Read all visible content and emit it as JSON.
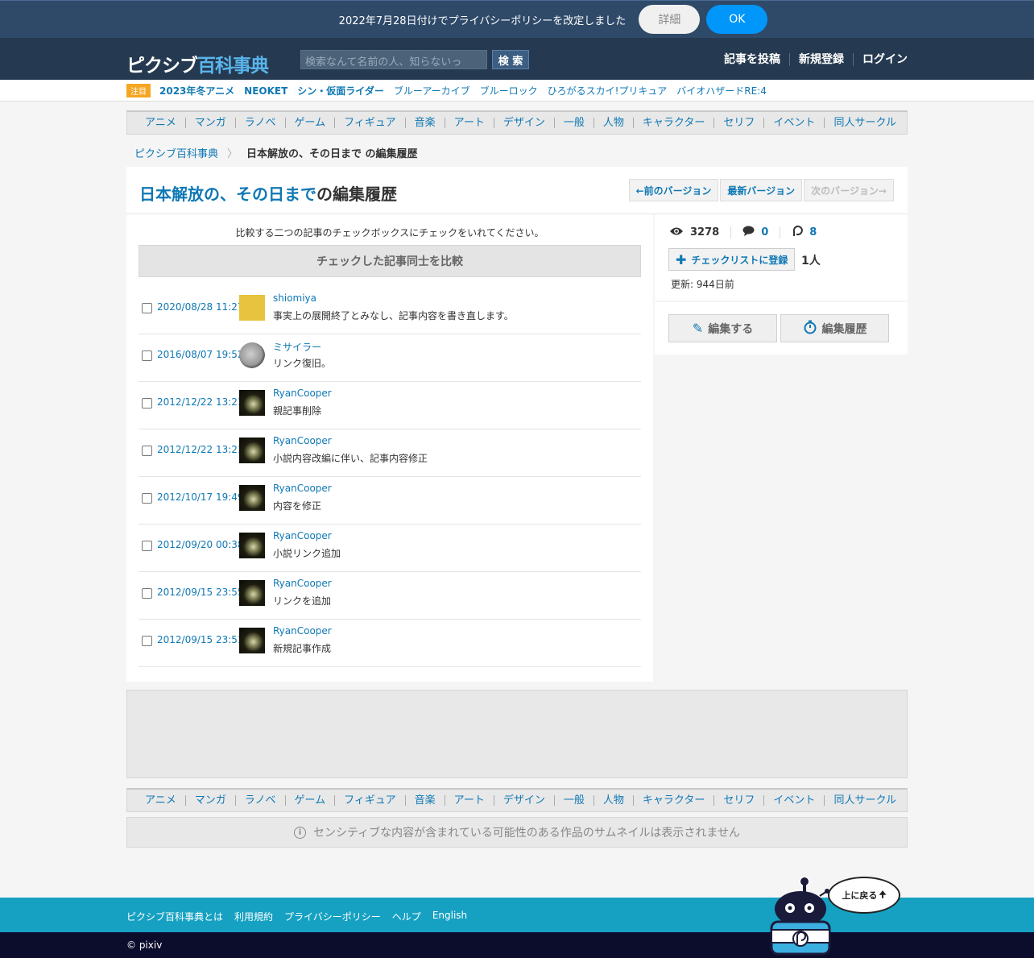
{
  "privacy_banner": {
    "message": "2022年7月28日付けでプライバシーポリシーを改定しました",
    "detail_label": "詳細",
    "ok_label": "OK"
  },
  "header": {
    "logo_part1": "ピクシブ",
    "logo_part2": "百科事典",
    "search_placeholder": "検索なんて名前の人、知らないっ",
    "search_label": "検 索",
    "links": [
      "記事を投稿",
      "新規登録",
      "ログイン"
    ]
  },
  "trending": {
    "badge": "注目",
    "items": [
      {
        "label": "2023年冬アニメ",
        "bold": true
      },
      {
        "label": "NEOKET",
        "bold": true
      },
      {
        "label": "シン・仮面ライダー",
        "bold": true
      },
      {
        "label": "ブルーアーカイブ",
        "bold": false
      },
      {
        "label": "ブルーロック",
        "bold": false
      },
      {
        "label": "ひろがるスカイ!プリキュア",
        "bold": false
      },
      {
        "label": "バイオハザードRE:4",
        "bold": false
      }
    ]
  },
  "categories": [
    "アニメ",
    "マンガ",
    "ラノベ",
    "ゲーム",
    "フィギュア",
    "音楽",
    "アート",
    "デザイン",
    "一般",
    "人物",
    "キャラクター",
    "セリフ",
    "イベント",
    "同人サークル"
  ],
  "breadcrumb": {
    "home": "ピクシブ百科事典",
    "separator": "〉",
    "current": "日本解放の、その日まで の編集履歴"
  },
  "title": {
    "article": "日本解放の、その日まで",
    "suffix": "の編集履歴"
  },
  "version_buttons": {
    "prev": "←前のバージョン",
    "latest": "最新バージョン",
    "next": "次のバージョン→"
  },
  "history": {
    "instruction": "比較する二つの記事のチェックボックスにチェックをいれてください。",
    "compare_label": "チェックした記事同士を比較",
    "rows": [
      {
        "date": "2020/08/28 11:27",
        "user": "shiomiya",
        "comment": "事実上の展開終了とみなし、記事内容を書き直します。",
        "avatar": "yellow"
      },
      {
        "date": "2016/08/07 19:52",
        "user": "ミサイラー",
        "comment": "リンク復旧。",
        "avatar": "coin"
      },
      {
        "date": "2012/12/22 13:21",
        "user": "RyanCooper",
        "comment": "親記事削除",
        "avatar": "dark"
      },
      {
        "date": "2012/12/22 13:21",
        "user": "RyanCooper",
        "comment": "小説内容改編に伴い、記事内容修正",
        "avatar": "dark"
      },
      {
        "date": "2012/10/17 19:49",
        "user": "RyanCooper",
        "comment": "内容を修正",
        "avatar": "dark"
      },
      {
        "date": "2012/09/20 00:38",
        "user": "RyanCooper",
        "comment": "小説リンク追加",
        "avatar": "dark"
      },
      {
        "date": "2012/09/15 23:55",
        "user": "RyanCooper",
        "comment": "リンクを追加",
        "avatar": "dark"
      },
      {
        "date": "2012/09/15 23:51",
        "user": "RyanCooper",
        "comment": "新規記事作成",
        "avatar": "dark"
      }
    ]
  },
  "sidebar": {
    "views": "3278",
    "comments": "0",
    "pixiv_count": "8",
    "checklist_label": "チェックリストに登録",
    "checklist_count": "1人",
    "updated_label": "更新:",
    "updated_value": "944日前",
    "edit_label": "編集する",
    "history_label": "編集履歴"
  },
  "notice": "センシティブな内容が含まれている可能性のある作品のサムネイルは表示されません",
  "footer": {
    "links": [
      "ピクシブ百科事典とは",
      "利用規約",
      "プライバシーポリシー",
      "ヘルプ",
      "English"
    ],
    "copyright": "© pixiv",
    "to_top": "上に戻る"
  },
  "colors": {
    "link": "#0f78b4",
    "header_bg": "#253a50",
    "banner_bg": "#2f4a69",
    "ok_button": "#0096fa",
    "footer_bg": "#16a1c2",
    "copyright_bg": "#0c0c2c",
    "badge": "#f5a623"
  }
}
